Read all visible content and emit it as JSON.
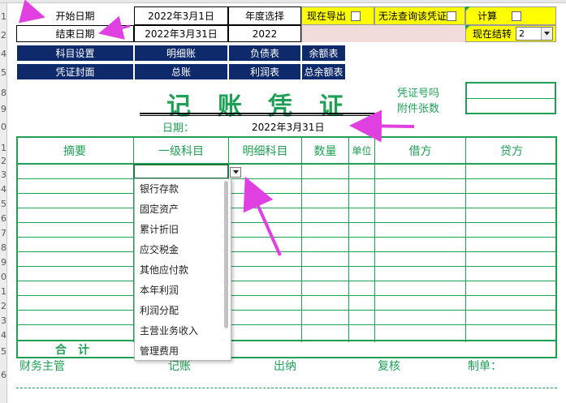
{
  "top": {
    "start_label": "开始日期",
    "start_value": "2022年3月1日",
    "end_label": "结束日期",
    "end_value": "2022年3月31日",
    "year_label": "年度选择",
    "year_value": "2022",
    "export_label": "现在导出",
    "noquery_label": "无法查询该凭证",
    "calc_label": "计算",
    "carry_label": "现在结转",
    "carry_value": "2"
  },
  "nav": [
    "科目设置",
    "明细账",
    "负债表",
    "余额表",
    "凭证封面",
    "总账",
    "利润表",
    "总余额表"
  ],
  "voucher": {
    "title_chars": [
      "记",
      "账",
      "凭",
      "证"
    ],
    "voucher_no_label": "凭证号吗",
    "attachments_label": "附件张数",
    "date_label": "日期：",
    "date_value": "2022年3月31日"
  },
  "table": {
    "headers": [
      "摘要",
      "一级科目",
      "明细科目",
      "数量",
      "单位",
      "借方",
      "贷方"
    ],
    "total_label": "合　计"
  },
  "footer": [
    "财务主管",
    "记账",
    "出纳",
    "复核",
    "制单："
  ],
  "dropdown": {
    "items": [
      "银行存款",
      "固定资产",
      "累计折旧",
      "应交税金",
      "其他应付款",
      "本年利润",
      "利润分配",
      "主营业务收入",
      "管理费用"
    ]
  },
  "row_numbers": [
    "1",
    "2",
    "4",
    "5",
    "8",
    "9",
    "0",
    "1",
    "2",
    "3",
    "4",
    "5",
    "6",
    "7",
    "8",
    "9",
    "0",
    "1",
    "2",
    "3",
    "4",
    "5",
    "6"
  ],
  "colors": {
    "green": "#1fa055",
    "navy": "#0e2a6a",
    "yellow": "#ffff00",
    "pink": "#f2dcdb",
    "arrow": "#e040e0"
  }
}
